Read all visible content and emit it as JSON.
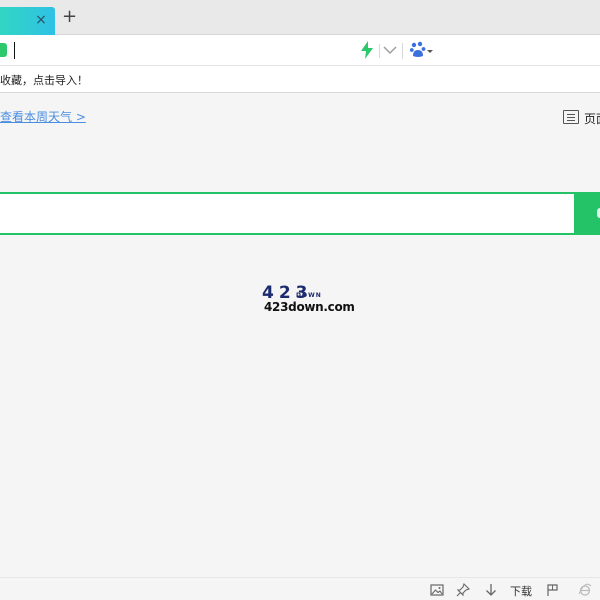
{
  "tabbar": {
    "active_tab_close_glyph": "×",
    "new_tab_glyph": "+"
  },
  "addressbar": {
    "value": "",
    "accelerate_icon": "lightning-bolt-icon",
    "dropdown_icon": "chevron-down-icon",
    "search_engine_icon": "baidu-paw-icon",
    "accent_color": "#2dc86b"
  },
  "infobar": {
    "text": "收藏，点击导入！"
  },
  "content": {
    "weather_link": "查看本周天气 >",
    "page_button_label": "页面",
    "search": {
      "value": "",
      "button_color": "#24c368"
    },
    "logo": {
      "digits": "423",
      "tagline": "DOWN",
      "domain": "423down.com",
      "color": "#1c2a6e"
    }
  },
  "statusbar": {
    "download_label": "下载",
    "icons": [
      "image-icon",
      "pin-icon",
      "download-arrow-icon",
      "flag-icon",
      "ie-icon"
    ]
  }
}
